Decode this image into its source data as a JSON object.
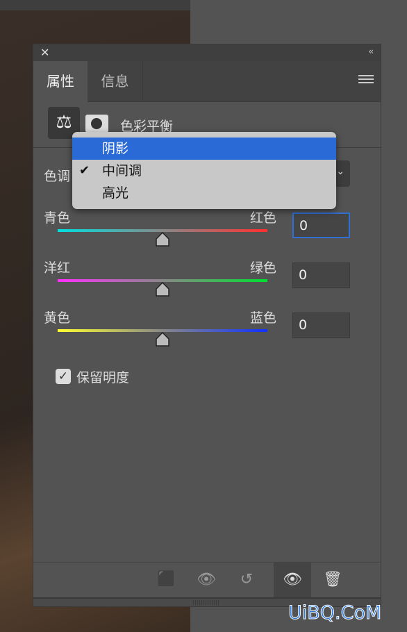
{
  "tabs": [
    "属性",
    "信息"
  ],
  "adjustment_name": "色彩平衡",
  "tone_label": "色调",
  "tone_options": [
    {
      "label": "阴影",
      "highlighted": true,
      "checked": false
    },
    {
      "label": "中间调",
      "highlighted": false,
      "checked": true
    },
    {
      "label": "高光",
      "highlighted": false,
      "checked": false
    }
  ],
  "sliders": [
    {
      "left": "青色",
      "right": "红色",
      "value": "0",
      "colors": [
        "#00e0e0",
        "#ff3030"
      ]
    },
    {
      "left": "洋红",
      "right": "绿色",
      "value": "0",
      "colors": [
        "#ff30ff",
        "#00e030"
      ]
    },
    {
      "left": "黄色",
      "right": "蓝色",
      "value": "0",
      "colors": [
        "#ffff30",
        "#1030ff"
      ]
    }
  ],
  "preserve_luminosity": {
    "label": "保留明度",
    "checked": true
  },
  "watermark": "UiBQ.CoM"
}
